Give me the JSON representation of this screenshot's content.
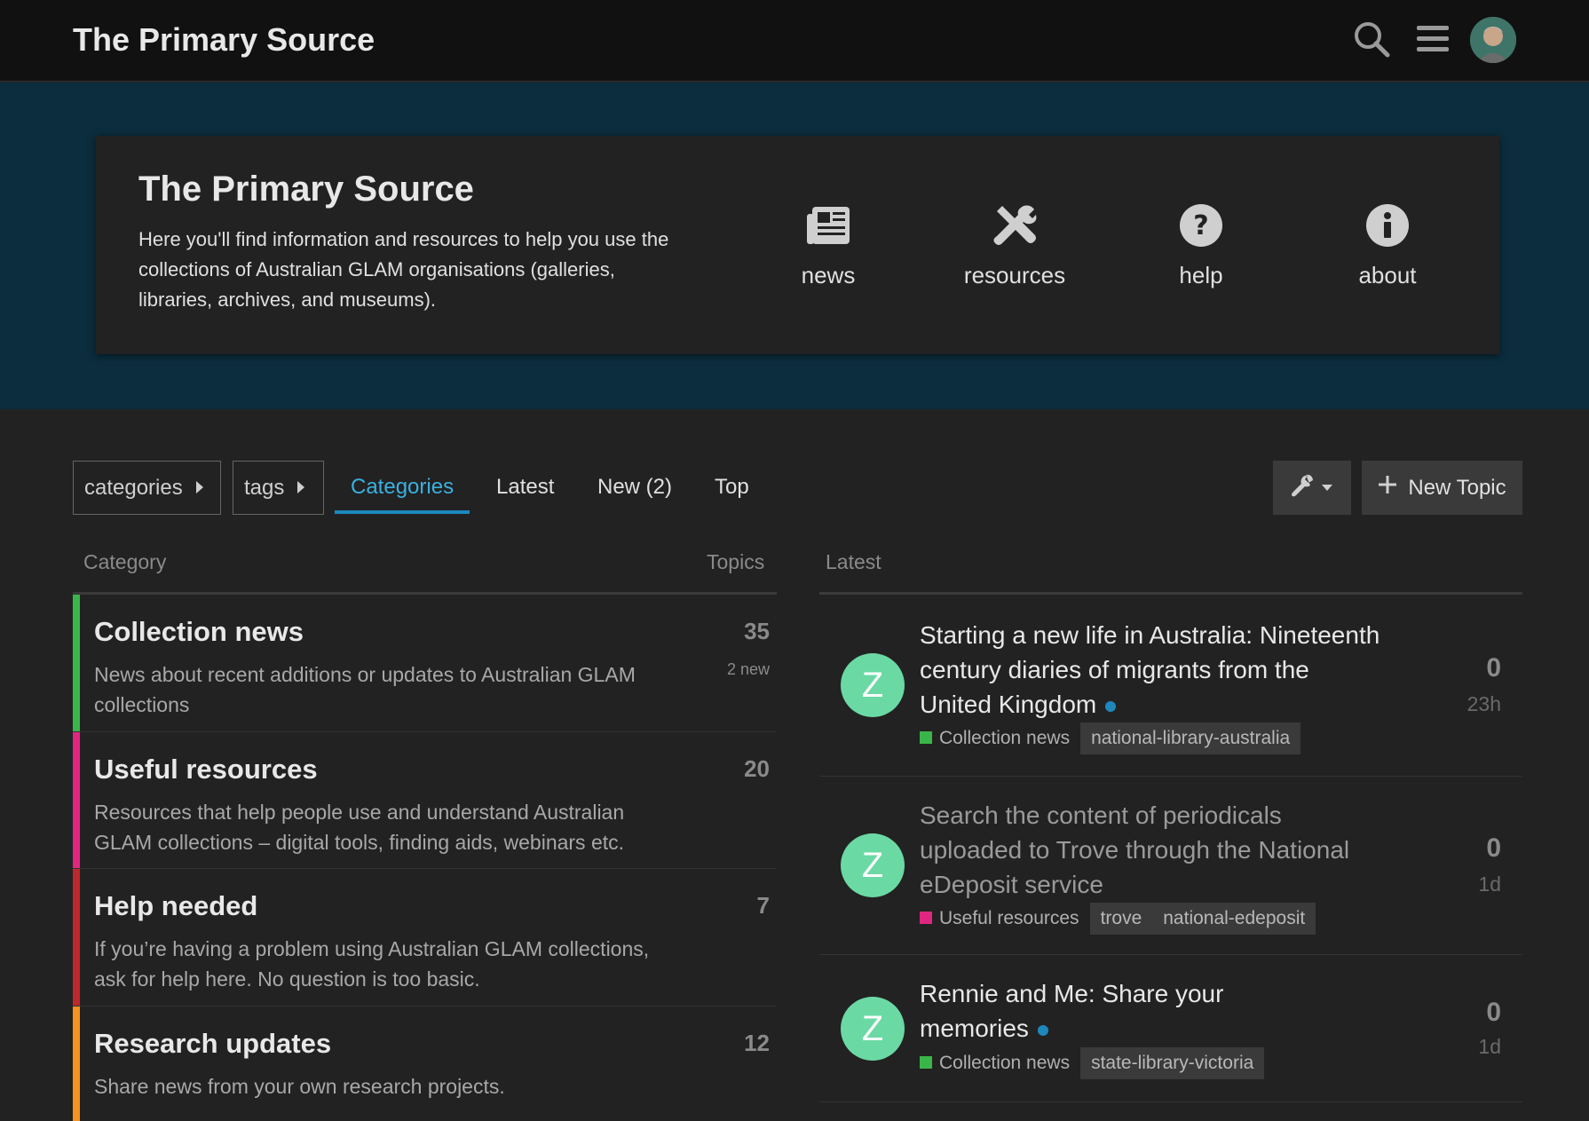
{
  "header": {
    "site_title": "The Primary Source",
    "icons": [
      "search-icon",
      "hamburger-menu-icon"
    ]
  },
  "banner": {
    "title": "The Primary Source",
    "text": "Here you'll find information and resources to help you use the collections of Australian GLAM organisations (galleries, libraries, archives, and museums).",
    "links": [
      {
        "label": "news",
        "icon": "newspaper-icon"
      },
      {
        "label": "resources",
        "icon": "tools-icon"
      },
      {
        "label": "help",
        "icon": "question-circle-icon"
      },
      {
        "label": "about",
        "icon": "info-circle-icon"
      }
    ]
  },
  "nav": {
    "categories_dropdown": "categories",
    "tags_dropdown": "tags",
    "tabs": [
      {
        "label": "Categories",
        "active": true
      },
      {
        "label": "Latest",
        "active": false
      },
      {
        "label": "New (2)",
        "active": false
      },
      {
        "label": "Top",
        "active": false
      }
    ],
    "new_topic": "New Topic"
  },
  "categories_table": {
    "col_category": "Category",
    "col_topics": "Topics",
    "rows": [
      {
        "name": "Collection news",
        "description": "News about recent additions or updates to Australian GLAM collections",
        "topics": "35",
        "new": "2 new",
        "color": "#3ab54a"
      },
      {
        "name": "Useful resources",
        "description": "Resources that help people use and understand Australian GLAM collections – digital tools, finding aids, webinars etc.",
        "topics": "20",
        "new": "",
        "color": "#e02680"
      },
      {
        "name": "Help needed",
        "description": "If you’re having a problem using Australian GLAM collections, ask for help here. No question is too basic.",
        "topics": "7",
        "new": "",
        "color": "#c0272d"
      },
      {
        "name": "Research updates",
        "description": "Share news from your own research projects.",
        "topics": "12",
        "new": "",
        "color": "#f7941d"
      }
    ]
  },
  "latest": {
    "header": "Latest",
    "topics": [
      {
        "avatar_letter": "Z",
        "title": "Starting a new life in Australia: Nineteenth century diaries of migrants from the United Kingdom",
        "category": "Collection news",
        "category_color": "#3ab54a",
        "tags": [
          "national-library-australia"
        ],
        "replies": "0",
        "age": "23h",
        "unread": true
      },
      {
        "avatar_letter": "Z",
        "title": "Search the content of periodicals uploaded to Trove through the National eDeposit service",
        "category": "Useful resources",
        "category_color": "#e02680",
        "tags": [
          "trove",
          "national-edeposit"
        ],
        "replies": "0",
        "age": "1d",
        "unread": false
      },
      {
        "avatar_letter": "Z",
        "title": "Rennie and Me: Share your memories",
        "category": "Collection news",
        "category_color": "#3ab54a",
        "tags": [
          "state-library-victoria"
        ],
        "replies": "0",
        "age": "1d",
        "unread": true
      }
    ]
  }
}
